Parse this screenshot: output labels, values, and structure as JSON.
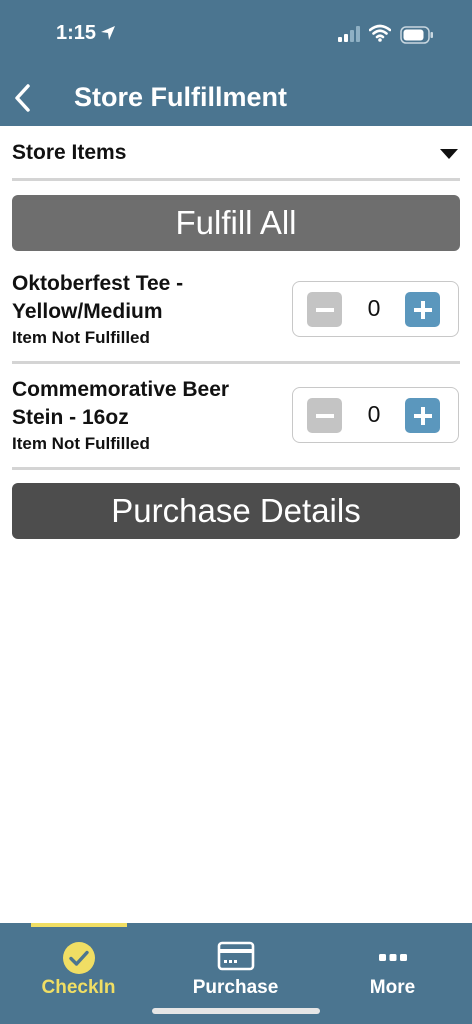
{
  "status_bar": {
    "time": "1:15"
  },
  "header": {
    "title": "Store Fulfillment"
  },
  "section": {
    "title": "Store Items"
  },
  "buttons": {
    "fulfill_all": "Fulfill All",
    "purchase_details": "Purchase Details"
  },
  "items": [
    {
      "name": "Oktoberfest Tee - Yellow/Medium",
      "status": "Item Not Fulfilled",
      "quantity": "0"
    },
    {
      "name": "Commemorative Beer Stein - 16oz",
      "status": "Item Not Fulfilled",
      "quantity": "0"
    }
  ],
  "tabs": [
    {
      "label": "CheckIn",
      "icon": "check-circle-icon",
      "active": true
    },
    {
      "label": "Purchase",
      "icon": "card-icon",
      "active": false
    },
    {
      "label": "More",
      "icon": "more-dots-icon",
      "active": false
    }
  ],
  "colors": {
    "header_bg": "#4b7590",
    "active_tab": "#f0de64",
    "plus_button": "#5b97bd",
    "minus_button": "#c4c4c4",
    "fulfill_all_bg": "#6e6e6e",
    "purchase_details_bg": "#4d4d4d"
  }
}
